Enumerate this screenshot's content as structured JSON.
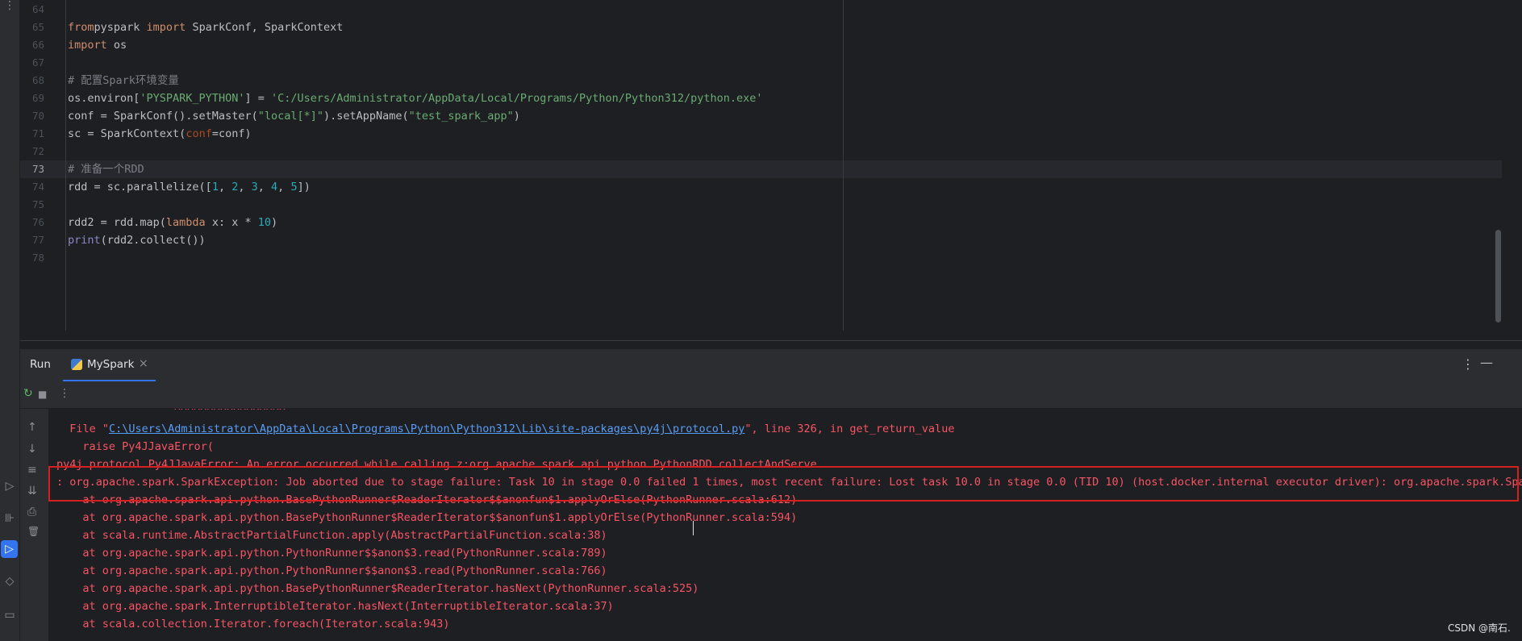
{
  "editor": {
    "current_line": "73",
    "lines": [
      {
        "no": "64",
        "segs": []
      },
      {
        "no": "65",
        "segs": [
          [
            "kw",
            "from"
          ],
          [
            "",
            "pyspark "
          ],
          [
            "kw",
            "import"
          ],
          [
            "",
            " SparkConf, SparkContext"
          ]
        ]
      },
      {
        "no": "66",
        "segs": [
          [
            "kw",
            "import"
          ],
          [
            "",
            " os"
          ]
        ]
      },
      {
        "no": "67",
        "segs": []
      },
      {
        "no": "68",
        "segs": [
          [
            "cmt",
            "# 配置Spark环境变量"
          ]
        ]
      },
      {
        "no": "69",
        "segs": [
          [
            "",
            "os.environ["
          ],
          [
            "str",
            "'PYSPARK_PYTHON'"
          ],
          [
            "",
            "] = "
          ],
          [
            "str",
            "'C:/Users/Administrator/AppData/Local/Programs/Python/Python312/python.exe'"
          ]
        ]
      },
      {
        "no": "70",
        "segs": [
          [
            "",
            "conf = SparkConf().setMaster("
          ],
          [
            "str",
            "\"local[*]\""
          ],
          [
            "",
            ").setAppName("
          ],
          [
            "str",
            "\"test_spark_app\""
          ],
          [
            "",
            ")"
          ]
        ]
      },
      {
        "no": "71",
        "segs": [
          [
            "",
            "sc = SparkContext("
          ],
          [
            "prm",
            "conf"
          ],
          [
            "",
            "=conf)"
          ]
        ]
      },
      {
        "no": "72",
        "segs": []
      },
      {
        "no": "73",
        "segs": [
          [
            "cmt",
            "# 准备一个RDD"
          ]
        ]
      },
      {
        "no": "74",
        "segs": [
          [
            "",
            "rdd = sc.parallelize(["
          ],
          [
            "num",
            "1"
          ],
          [
            "",
            ", "
          ],
          [
            "num",
            "2"
          ],
          [
            "",
            ", "
          ],
          [
            "num",
            "3"
          ],
          [
            "",
            ", "
          ],
          [
            "num",
            "4"
          ],
          [
            "",
            ", "
          ],
          [
            "num",
            "5"
          ],
          [
            "",
            "])"
          ]
        ]
      },
      {
        "no": "75",
        "segs": []
      },
      {
        "no": "76",
        "segs": [
          [
            "",
            "rdd2 = rdd.map("
          ],
          [
            "kw",
            "lambda"
          ],
          [
            "",
            " x: x * "
          ],
          [
            "num",
            "10"
          ],
          [
            "",
            ")"
          ]
        ]
      },
      {
        "no": "77",
        "segs": [
          [
            "bi",
            "print"
          ],
          [
            "",
            "(rdd2.collect())"
          ]
        ]
      },
      {
        "no": "78",
        "segs": []
      }
    ]
  },
  "run_panel": {
    "title": "Run",
    "tab_label": "MySpark",
    "tab_close_icon": "×",
    "more_icon": "⋮",
    "minimize_icon": "—"
  },
  "toolbar": {
    "rerun_icon": "↻",
    "stop_icon": "■",
    "more_icon": "⋮"
  },
  "side_icons": [
    "↑",
    "↓",
    "≡",
    "⇊",
    "⎙",
    "🗑"
  ],
  "console": {
    "lines": [
      {
        "indent": 18,
        "pre": "^^^^^^^^^^^^^^^^^",
        "link": "",
        "post": ""
      },
      {
        "indent": 2,
        "pre": "File \"",
        "link": "C:\\Users\\Administrator\\AppData\\Local\\Programs\\Python\\Python312\\Lib\\site-packages\\py4j\\protocol.py",
        "post": "\", line 326, in get_return_value"
      },
      {
        "indent": 4,
        "pre": "raise Py4JJavaError(",
        "link": "",
        "post": ""
      },
      {
        "indent": 0,
        "pre": "py4j.protocol.Py4JJavaError: An error occurred while calling z:org.apache.spark.api.python.PythonRDD.collectAndServe.",
        "link": "",
        "post": ""
      },
      {
        "indent": 0,
        "pre": ": org.apache.spark.SparkException: Job aborted due to stage failure: Task 10 in stage 0.0 failed 1 times, most recent failure: Lost task 10.0 in stage 0.0 (TID 10) (host.docker.internal executor driver): org.apache.spark.Spar",
        "link": "",
        "post": ""
      },
      {
        "indent": 4,
        "pre": "at org.apache.spark.api.python.BasePythonRunner$ReaderIterator$$anonfun$1.applyOrElse(PythonRunner.scala:612)",
        "link": "",
        "post": ""
      },
      {
        "indent": 4,
        "pre": "at org.apache.spark.api.python.BasePythonRunner$ReaderIterator$$anonfun$1.applyOrElse(PythonRunner.scala:594)",
        "link": "",
        "post": ""
      },
      {
        "indent": 4,
        "pre": "at scala.runtime.AbstractPartialFunction.apply(AbstractPartialFunction.scala:38)",
        "link": "",
        "post": ""
      },
      {
        "indent": 4,
        "pre": "at org.apache.spark.api.python.PythonRunner$$anon$3.read(PythonRunner.scala:789)",
        "link": "",
        "post": ""
      },
      {
        "indent": 4,
        "pre": "at org.apache.spark.api.python.PythonRunner$$anon$3.read(PythonRunner.scala:766)",
        "link": "",
        "post": ""
      },
      {
        "indent": 4,
        "pre": "at org.apache.spark.api.python.BasePythonRunner$ReaderIterator.hasNext(PythonRunner.scala:525)",
        "link": "",
        "post": ""
      },
      {
        "indent": 4,
        "pre": "at org.apache.spark.InterruptibleIterator.hasNext(InterruptibleIterator.scala:37)",
        "link": "",
        "post": ""
      },
      {
        "indent": 4,
        "pre": "at scala.collection.Iterator.foreach(Iterator.scala:943)",
        "link": "",
        "post": ""
      }
    ]
  },
  "watermark": "CSDN @南石.",
  "colors": {
    "accent": "#3574f0",
    "error_text": "#f75464",
    "error_box": "#d61f1f",
    "link": "#589df6"
  }
}
